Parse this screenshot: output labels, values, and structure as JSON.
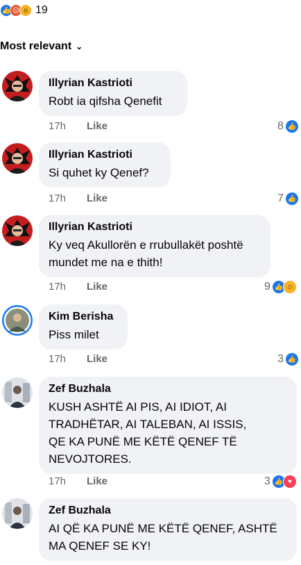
{
  "reactions": {
    "total": "19",
    "types": [
      "like-icon",
      "angry-icon",
      "wow-icon"
    ]
  },
  "sort": {
    "label": "Most relevant"
  },
  "colors": {
    "like": "#1877f2",
    "love": "#f33e58",
    "haha": "#f7b125",
    "bubble": "#f0f2f5",
    "meta": "#65676b"
  },
  "like_label": "Like",
  "comments": [
    {
      "author": "Illyrian Kastrioti",
      "lines": [
        "Robt ia qifsha Qenefit"
      ],
      "time": "17h",
      "count": "8",
      "reactions": [
        "like"
      ]
    },
    {
      "author": "Illyrian Kastrioti",
      "lines": [
        "Si quhet ky Qenef?"
      ],
      "time": "17h",
      "count": "7",
      "reactions": [
        "like"
      ]
    },
    {
      "author": "Illyrian Kastrioti",
      "lines": [
        "Ky veq Akullorën e rrubullakët poshtë",
        "mundet me na e thith!"
      ],
      "time": "17h",
      "count": "9",
      "reactions": [
        "like",
        "haha"
      ]
    },
    {
      "author": "Kim Berisha",
      "lines": [
        "Piss milet"
      ],
      "time": "17h",
      "count": "3",
      "reactions": [
        "like"
      ]
    },
    {
      "author": "Zef Buzhala",
      "lines": [
        "KUSH ASHTË AI PIS, AI IDIOT, AI",
        "TRADHËTAR, AI TALEBAN, AI ISSIS,",
        "QE KA PUNË ME KËTË QENEF TË",
        "NEVOJTORES."
      ],
      "time": "17h",
      "count": "3",
      "reactions": [
        "like",
        "love"
      ]
    },
    {
      "author": "Zef Buzhala",
      "lines": [
        "AI QË KA PUNË ME KËTË QENEF, ASHTË",
        "MA QENEF SE KY!"
      ],
      "time": "",
      "count": "",
      "reactions": []
    }
  ]
}
